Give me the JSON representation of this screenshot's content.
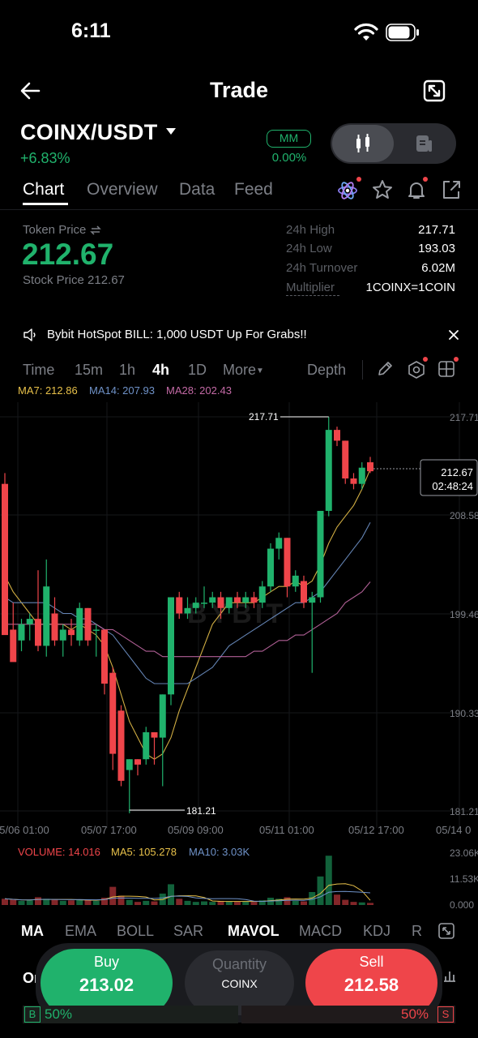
{
  "status_bar": {
    "time": "6:11"
  },
  "header": {
    "title": "Trade"
  },
  "pair": {
    "name": "COINX/USDT",
    "change": "+6.83%",
    "mm_label": "MM",
    "mm_value": "0.00%"
  },
  "tabs": [
    "Chart",
    "Overview",
    "Data",
    "Feed"
  ],
  "price": {
    "token_label": "Token Price",
    "token_value": "212.67",
    "stock_label": "Stock Price 212.67"
  },
  "stats": [
    {
      "label": "24h High",
      "value": "217.71"
    },
    {
      "label": "24h Low",
      "value": "193.03"
    },
    {
      "label": "24h Turnover",
      "value": "6.02M"
    },
    {
      "label": "Multiplier",
      "value": "1COINX=1COIN"
    }
  ],
  "banner": {
    "text": "Bybit HotSpot BILL: 1,000 USDT Up For Grabs!!"
  },
  "intervals": {
    "items": [
      "Time",
      "15m",
      "1h",
      "4h",
      "1D",
      "More"
    ],
    "active": "4h",
    "depth": "Depth"
  },
  "ma_legend": {
    "ma7": "MA7: 212.86",
    "ma14": "MA14: 207.93",
    "ma28": "MA28: 202.43"
  },
  "vol_legend": {
    "volume": "VOLUME: 14.016",
    "ma5": "MA5: 105.278",
    "ma10": "MA10: 3.03K"
  },
  "indicators": {
    "items": [
      "MA",
      "EMA",
      "BOLL",
      "SAR",
      "MAVOL",
      "MACD",
      "KDJ",
      "R"
    ],
    "active": [
      "MA",
      "MAVOL"
    ]
  },
  "actions": {
    "buy_label": "Buy",
    "buy_price": "213.02",
    "qty_label": "Quantity",
    "qty_unit": "COINX",
    "sell_label": "Sell",
    "sell_price": "212.58"
  },
  "ratio": {
    "buy": "50%",
    "sell": "50%",
    "b": "B",
    "s": "S",
    "partial_tab": "Or"
  },
  "colors": {
    "up": "#20b26c",
    "down": "#ef454a",
    "ma7": "#e8c14a",
    "ma14": "#6f92c8",
    "ma28": "#c46aa6"
  },
  "chart_data": {
    "type": "candlestick",
    "watermark": "BYBIT",
    "price_axis": [
      "217.71",
      "208.58",
      "199.46",
      "190.33",
      "181.21"
    ],
    "ylim": [
      181.21,
      217.71
    ],
    "time_axis": [
      "05/06 01:00",
      "05/07 17:00",
      "05/09 09:00",
      "05/11 01:00",
      "05/12 17:00",
      "05/14 0"
    ],
    "high_marker": "217.71",
    "low_marker": "181.21",
    "current_price": "212.67",
    "countdown": "02:48:24",
    "volume_axis": [
      "23.06K",
      "11.53K",
      "0.000"
    ],
    "candles": [
      [
        211.5,
        212.5,
        198.0,
        197.5
      ],
      [
        198.0,
        200.5,
        196.5,
        195.0
      ],
      [
        197.0,
        199.0,
        196.0,
        198.5
      ],
      [
        198.5,
        199.5,
        197.0,
        199.0
      ],
      [
        199.0,
        203.5,
        196.0,
        196.5
      ],
      [
        196.5,
        204.5,
        195.5,
        202.0
      ],
      [
        199.5,
        201.0,
        196.5,
        197.0
      ],
      [
        197.0,
        198.5,
        195.5,
        198.0
      ],
      [
        198.0,
        199.0,
        196.5,
        197.5
      ],
      [
        197.0,
        200.5,
        196.5,
        200.0
      ],
      [
        200.0,
        200.0,
        196.5,
        197.0
      ],
      [
        198.0,
        198.5,
        195.5,
        198.0
      ],
      [
        198.0,
        198.0,
        192.0,
        193.0
      ],
      [
        194.0,
        194.5,
        185.0,
        186.5
      ],
      [
        190.5,
        191.0,
        183.5,
        184.0
      ],
      [
        185.0,
        186.0,
        181.0,
        186.0
      ],
      [
        186.0,
        186.0,
        184.5,
        185.5
      ],
      [
        186.0,
        189.0,
        185.5,
        188.5
      ],
      [
        188.5,
        188.5,
        185.5,
        188.0
      ],
      [
        188.0,
        192.0,
        183.5,
        192.0
      ],
      [
        192.0,
        201.0,
        191.0,
        201.0
      ],
      [
        201.0,
        201.5,
        199.0,
        199.5
      ],
      [
        199.5,
        201.0,
        199.0,
        200.0
      ],
      [
        200.0,
        201.0,
        199.5,
        200.5
      ],
      [
        200.5,
        202.0,
        200.0,
        200.5
      ],
      [
        200.5,
        201.5,
        200.0,
        201.0
      ],
      [
        201.0,
        201.5,
        199.0,
        200.0
      ],
      [
        200.0,
        201.0,
        199.5,
        201.0
      ],
      [
        201.0,
        201.5,
        200.0,
        200.5
      ],
      [
        200.5,
        201.5,
        200.0,
        201.0
      ],
      [
        201.0,
        201.5,
        200.0,
        200.5
      ],
      [
        200.5,
        202.5,
        200.0,
        202.0
      ],
      [
        202.0,
        206.0,
        201.5,
        205.5
      ],
      [
        205.5,
        207.0,
        204.5,
        206.5
      ],
      [
        206.5,
        206.5,
        201.0,
        202.0
      ],
      [
        202.0,
        203.5,
        201.5,
        203.0
      ],
      [
        202.5,
        203.0,
        200.0,
        200.5
      ],
      [
        200.5,
        201.5,
        194.0,
        201.0
      ],
      [
        201.0,
        209.0,
        200.5,
        209.0
      ],
      [
        209.0,
        217.7,
        208.5,
        216.5
      ],
      [
        216.5,
        216.8,
        215.0,
        215.5
      ],
      [
        215.5,
        215.5,
        211.5,
        212.0
      ],
      [
        212.0,
        212.5,
        211.0,
        211.5
      ],
      [
        211.5,
        213.5,
        211.0,
        213.0
      ],
      [
        213.5,
        214.0,
        212.5,
        212.67
      ]
    ],
    "volumes": [
      0.12,
      0.1,
      0.08,
      0.09,
      0.15,
      0.12,
      0.1,
      0.08,
      0.09,
      0.11,
      0.1,
      0.08,
      0.14,
      0.35,
      0.18,
      0.1,
      0.06,
      0.08,
      0.07,
      0.22,
      0.4,
      0.12,
      0.08,
      0.06,
      0.07,
      0.06,
      0.08,
      0.07,
      0.06,
      0.07,
      0.06,
      0.09,
      0.14,
      0.12,
      0.15,
      0.08,
      0.07,
      0.25,
      0.55,
      0.95,
      0.2,
      0.1,
      0.06,
      0.05,
      0.04
    ],
    "series": [
      {
        "name": "MA7",
        "values": [
          203.0,
          201.5,
          200.5,
          199.5,
          198.5,
          198.5,
          198.5,
          198.5,
          198.0,
          198.5,
          198.0,
          197.5,
          196.5,
          194.5,
          192.0,
          189.5,
          188.0,
          186.5,
          186.0,
          186.5,
          188.0,
          190.5,
          192.5,
          194.5,
          196.5,
          198.5,
          199.5,
          200.5,
          200.5,
          200.5,
          200.5,
          201.0,
          201.5,
          202.0,
          202.0,
          202.5,
          202.0,
          202.5,
          204.0,
          206.0,
          207.5,
          208.5,
          209.5,
          211.0,
          212.86
        ]
      },
      {
        "name": "MA14",
        "values": [
          201.0,
          200.5,
          200.5,
          200.5,
          200.5,
          200.5,
          200.0,
          199.5,
          199.5,
          199.0,
          199.0,
          198.5,
          198.0,
          197.5,
          196.5,
          195.5,
          194.5,
          193.5,
          193.0,
          193.0,
          193.0,
          193.0,
          193.0,
          193.5,
          194.0,
          194.5,
          195.5,
          196.5,
          197.0,
          197.5,
          198.0,
          198.5,
          199.0,
          199.5,
          200.0,
          200.5,
          200.5,
          201.0,
          201.5,
          202.5,
          203.5,
          204.5,
          205.5,
          206.5,
          207.93
        ]
      },
      {
        "name": "MA28",
        "values": [
          198.5,
          198.5,
          198.5,
          198.5,
          198.5,
          198.5,
          198.5,
          198.5,
          198.5,
          198.5,
          198.5,
          198.5,
          198.0,
          198.0,
          197.5,
          197.0,
          196.5,
          196.0,
          196.0,
          195.5,
          195.5,
          195.5,
          195.5,
          195.5,
          195.5,
          195.5,
          195.5,
          195.5,
          195.5,
          195.5,
          196.0,
          196.0,
          196.5,
          197.0,
          197.0,
          197.5,
          197.5,
          198.0,
          198.5,
          199.0,
          199.5,
          200.5,
          201.0,
          201.5,
          202.43
        ]
      }
    ]
  }
}
